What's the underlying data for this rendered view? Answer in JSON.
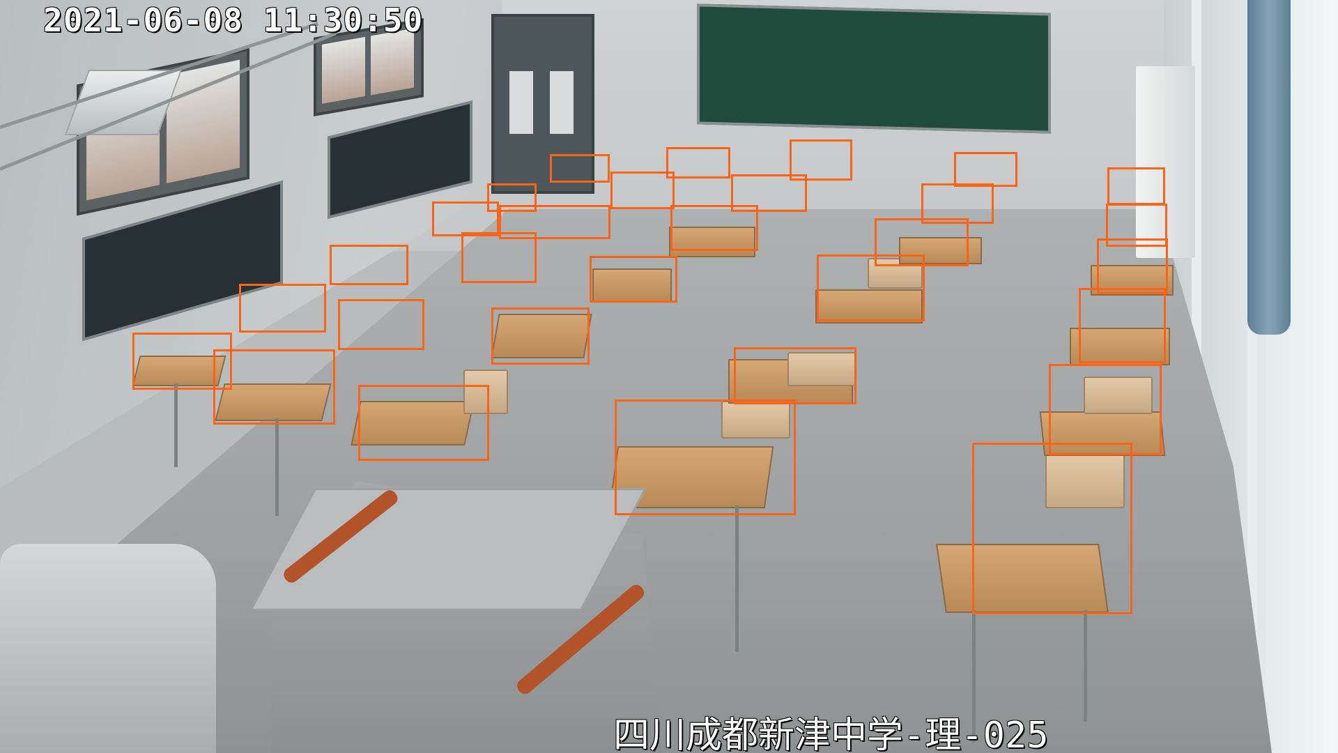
{
  "osd": {
    "timestamp": "2021-06-08 11:30:50",
    "camera_label": "四川成都新津中学-理-025"
  },
  "detections": {
    "label": "desk",
    "box_color": "#fb6417",
    "count": 33
  }
}
